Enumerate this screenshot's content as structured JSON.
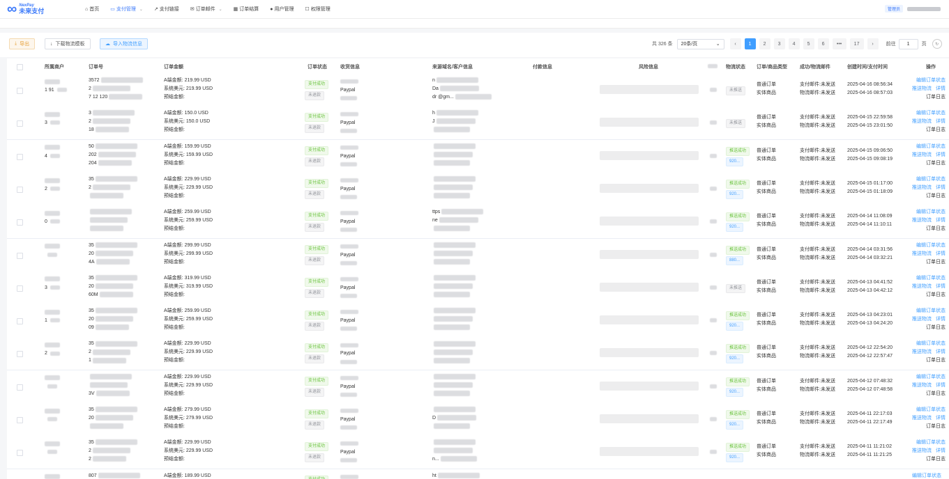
{
  "brand": {
    "en": "NexPay",
    "cn": "未来支付"
  },
  "nav": [
    {
      "label": "首页",
      "icon": "home-icon",
      "glyph": "⌂",
      "active": false,
      "dropdown": false
    },
    {
      "label": "支付管理",
      "icon": "card-icon",
      "glyph": "▭",
      "active": true,
      "dropdown": true
    },
    {
      "label": "支付链接",
      "icon": "link-icon",
      "glyph": "↗",
      "active": false,
      "dropdown": false
    },
    {
      "label": "订单邮件",
      "icon": "mail-icon",
      "glyph": "✉",
      "active": false,
      "dropdown": true
    },
    {
      "label": "订单结算",
      "icon": "grid-icon",
      "glyph": "▦",
      "active": false,
      "dropdown": false
    },
    {
      "label": "用户管理",
      "icon": "user-icon",
      "glyph": "●",
      "active": false,
      "dropdown": false
    },
    {
      "label": "权限管理",
      "icon": "lock-icon",
      "glyph": "☐",
      "active": false,
      "dropdown": false
    }
  ],
  "admin": {
    "role": "管理员"
  },
  "toolbar": {
    "export": "导出",
    "download": "下载物流模板",
    "import": "导入物流信息"
  },
  "pagination": {
    "total": "共 326 条",
    "page_size": "20条/页",
    "pages": [
      "1",
      "2",
      "3",
      "4",
      "5",
      "6",
      "•••",
      "17"
    ],
    "current": "1",
    "goto_label": "前往",
    "goto_value": "1",
    "unit": "页"
  },
  "columns": [
    "所属商户",
    "订单号",
    "订单金额",
    "订单状态",
    "收货信息",
    "来源域名/客户信息",
    "付款信息",
    "风险信息",
    "物流状态",
    "订单/商品类型",
    "成功/物流邮件",
    "创建时间/支付时间",
    "操作"
  ],
  "labels": {
    "a_amount": "A端金额:",
    "sys_usd": "系统美元:",
    "settle": "预结金额:",
    "paid": "支付成功",
    "no_refund": "未退款",
    "paypal": "Paypal",
    "order_type": "普通订单",
    "goods_type": "实体商品",
    "mail_pay": "支付邮件:未发送",
    "mail_logistics": "物流邮件:未发送",
    "action_edit": "编辑订单状态",
    "action_push": "推送物流",
    "action_detail": "详情",
    "action_log": "订单日志",
    "ship_success": "推送成功",
    "unshipped": "未推送"
  },
  "rows": [
    {
      "merchant": "1  91",
      "order_frag": [
        "3572",
        "2",
        "7    12  120"
      ],
      "amount": "219.99 USD",
      "usd": "219.99 USD",
      "logistics": "unshipped",
      "track": "",
      "created": "2025-04-16 08:56:34",
      "paid_at": "2025-04-16 08:57:03",
      "src_frag": [
        "n",
        "Da",
        "dr              @gm..."
      ]
    },
    {
      "merchant": "3",
      "order_frag": [
        "3",
        "2",
        "18"
      ],
      "amount": "150.0 USD",
      "usd": "150.0 USD",
      "logistics": "unshipped",
      "track": "",
      "created": "2025-04-15 22:59:58",
      "paid_at": "2025-04-15 23:01:50",
      "src_frag": [
        "h",
        "J",
        ""
      ]
    },
    {
      "merchant": "4",
      "order_frag": [
        "50",
        "202",
        "204"
      ],
      "amount": "159.99 USD",
      "usd": "159.99 USD",
      "logistics": "ship_success",
      "track": "920...",
      "created": "2025-04-15 09:06:50",
      "paid_at": "2025-04-15 09:08:19",
      "src_frag": [
        "",
        "",
        ""
      ]
    },
    {
      "merchant": "2",
      "order_frag": [
        "35",
        "2",
        ""
      ],
      "amount": "229.99 USD",
      "usd": "229.99 USD",
      "logistics": "ship_success",
      "track": "920...",
      "created": "2025-04-15 01:17:00",
      "paid_at": "2025-04-15 01:18:09",
      "src_frag": [
        "",
        "",
        ""
      ]
    },
    {
      "merchant": "0",
      "order_frag": [
        "",
        "",
        ""
      ],
      "amount": "259.99 USD",
      "usd": "259.99 USD",
      "logistics": "ship_success",
      "track": "920...",
      "created": "2025-04-14 11:08:09",
      "paid_at": "2025-04-14 11:10:11",
      "src_frag": [
        "ttps",
        "ne",
        ""
      ]
    },
    {
      "merchant": "",
      "order_frag": [
        "35",
        "20",
        "4A"
      ],
      "amount": "299.99 USD",
      "usd": "299.99 USD",
      "logistics": "ship_success",
      "track": "880...",
      "created": "2025-04-14 03:31:56",
      "paid_at": "2025-04-14 03:32:21",
      "src_frag": [
        "",
        "",
        ""
      ]
    },
    {
      "merchant": "3",
      "order_frag": [
        "35",
        "20",
        "60M"
      ],
      "amount": "319.99 USD",
      "usd": "319.99 USD",
      "logistics": "unshipped",
      "track": "",
      "created": "2025-04-13 04:41:52",
      "paid_at": "2025-04-13 04:42:12",
      "src_frag": [
        "",
        "",
        ""
      ]
    },
    {
      "merchant": "1",
      "order_frag": [
        "35",
        "20",
        "09"
      ],
      "amount": "259.99 USD",
      "usd": "259.99 USD",
      "logistics": "ship_success",
      "track": "920...",
      "created": "2025-04-13 04:23:01",
      "paid_at": "2025-04-13 04:24:20",
      "src_frag": [
        "",
        "",
        ""
      ]
    },
    {
      "merchant": "2",
      "order_frag": [
        "35",
        "2",
        "1"
      ],
      "amount": "229.99 USD",
      "usd": "229.99 USD",
      "logistics": "ship_success",
      "track": "920...",
      "created": "2025-04-12 22:54:20",
      "paid_at": "2025-04-12 22:57:47",
      "src_frag": [
        "",
        "",
        ""
      ]
    },
    {
      "merchant": "",
      "order_frag": [
        "",
        "",
        "3V"
      ],
      "amount": "229.99 USD",
      "usd": "229.99 USD",
      "logistics": "ship_success",
      "track": "920...",
      "created": "2025-04-12 07:48:32",
      "paid_at": "2025-04-12 07:48:58",
      "src_frag": [
        "",
        "",
        ""
      ]
    },
    {
      "merchant": "",
      "order_frag": [
        "35",
        "20",
        ""
      ],
      "amount": "279.99 USD",
      "usd": "279.99 USD",
      "logistics": "ship_success",
      "track": "920...",
      "created": "2025-04-11 22:17:03",
      "paid_at": "2025-04-11 22:17:49",
      "src_frag": [
        "",
        "D",
        ""
      ]
    },
    {
      "merchant": "",
      "order_frag": [
        "35",
        "2",
        "2"
      ],
      "amount": "229.99 USD",
      "usd": "229.99 USD",
      "logistics": "ship_success",
      "track": "920...",
      "created": "2025-04-11 11:21:02",
      "paid_at": "2025-04-11 11:21:25",
      "src_frag": [
        "",
        "",
        "n..."
      ]
    },
    {
      "merchant": "",
      "order_frag": [
        "807",
        "",
        ""
      ],
      "amount": "189.99 USD",
      "usd": "",
      "logistics": "",
      "track": "",
      "created": "",
      "paid_at": "",
      "src_frag": [
        "ht",
        "",
        ""
      ]
    }
  ]
}
